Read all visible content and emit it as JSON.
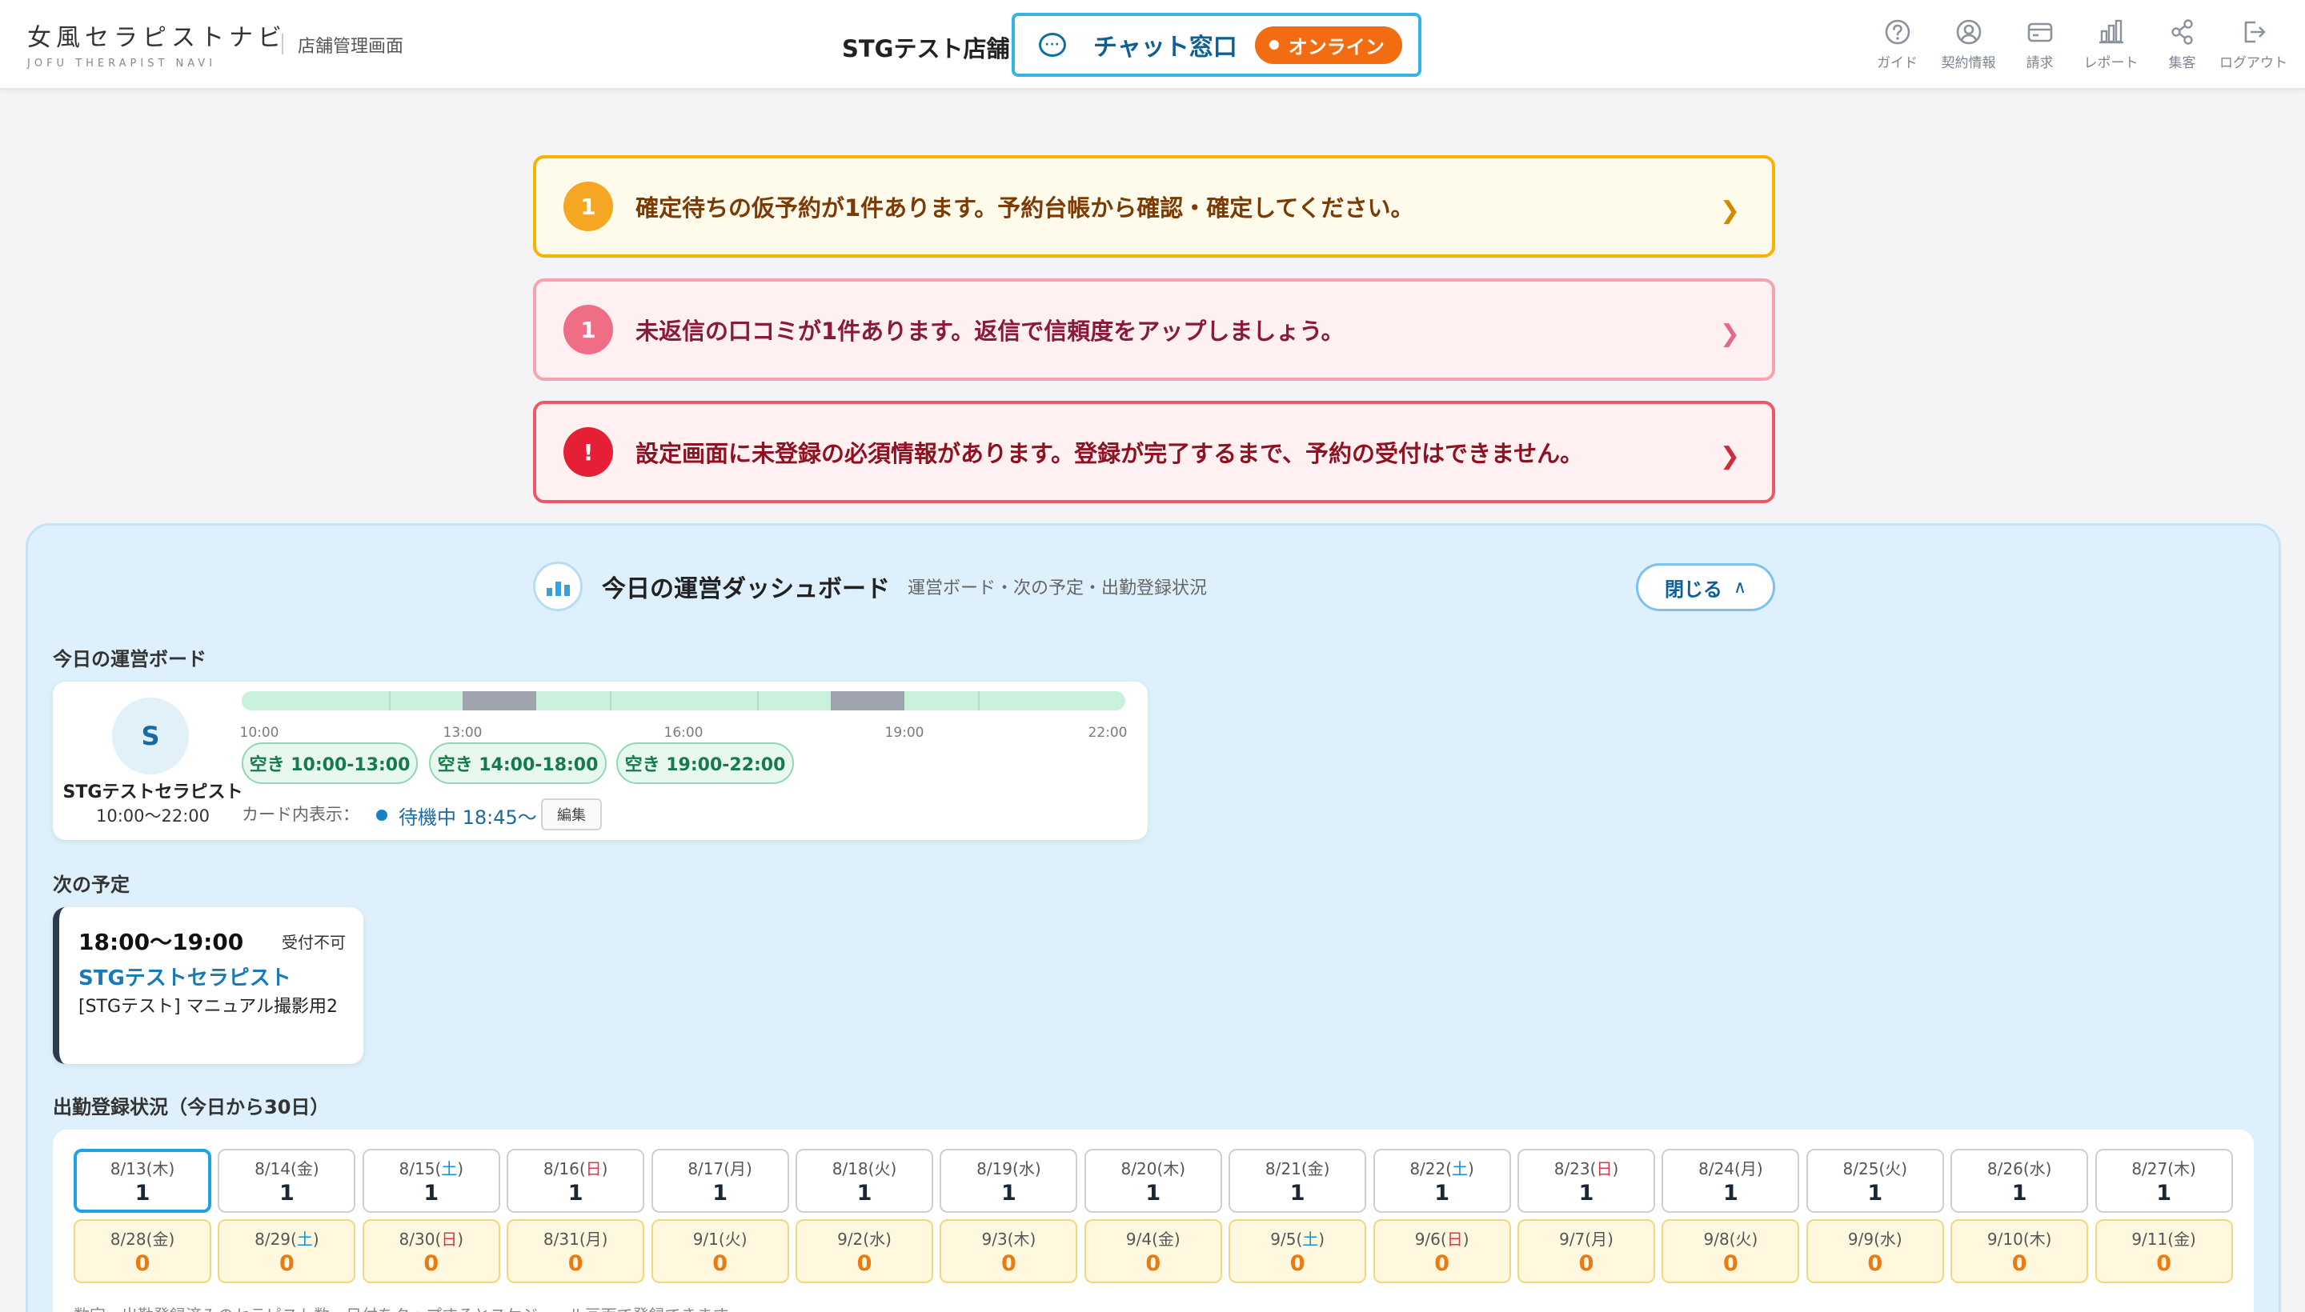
{
  "header": {
    "logo_main": "女風セラピストナビ",
    "logo_sub": "JOFU THERAPIST NAVI",
    "area_label": "店舗管理画面",
    "store_name": "STGテスト店舗",
    "chat_label": "チャット窓口",
    "online_label": "オンライン",
    "nav": [
      {
        "label": "ガイド",
        "icon": "question-circle-icon"
      },
      {
        "label": "契約情報",
        "icon": "user-circle-icon"
      },
      {
        "label": "請求",
        "icon": "credit-card-icon"
      },
      {
        "label": "レポート",
        "icon": "bar-chart-icon"
      },
      {
        "label": "集客",
        "icon": "share-icon"
      },
      {
        "label": "ログアウト",
        "icon": "logout-icon"
      }
    ]
  },
  "alerts": [
    {
      "num": "1",
      "text": "確定待ちの仮予約が1件あります。予約台帳から確認・確定してください。"
    },
    {
      "num": "1",
      "text": "未返信の口コミが1件あります。返信で信頼度をアップしましょう。"
    },
    {
      "num": "!",
      "text": "設定画面に未登録の必須情報があります。登録が完了するまで、予約の受付はできません。"
    }
  ],
  "dashboard": {
    "title": "今日の運営ダッシュボード",
    "subtitle": "運営ボード・次の予定・出勤登録状況",
    "close_label": "閉じる",
    "board_label": "今日の運営ボード",
    "next_label": "次の予定",
    "attendance_label": "出勤登録状況（今日から30日）"
  },
  "board": {
    "avatar": "S",
    "therapist_name": "STGテストセラピスト",
    "hours": "10:00〜22:00",
    "timeline_labels": [
      "10:00",
      "13:00",
      "16:00",
      "19:00",
      "22:00"
    ],
    "slots": [
      "空き 10:00-13:00",
      "空き 14:00-18:00",
      "空き 19:00-22:00"
    ],
    "card_display_label": "カード内表示：",
    "status_text": "待機中 18:45〜",
    "edit_label": "編集"
  },
  "next": {
    "time": "18:00〜19:00",
    "status": "受付不可",
    "therapist": "STGテストセラピスト",
    "course": "[STGテスト] マニュアル撮影用2"
  },
  "attendance": {
    "row1": [
      {
        "date": "8/13",
        "dow": "木",
        "count": "1",
        "today": true
      },
      {
        "date": "8/14",
        "dow": "金",
        "count": "1"
      },
      {
        "date": "8/15",
        "dow": "土",
        "count": "1"
      },
      {
        "date": "8/16",
        "dow": "日",
        "count": "1"
      },
      {
        "date": "8/17",
        "dow": "月",
        "count": "1"
      },
      {
        "date": "8/18",
        "dow": "火",
        "count": "1"
      },
      {
        "date": "8/19",
        "dow": "水",
        "count": "1"
      },
      {
        "date": "8/20",
        "dow": "木",
        "count": "1"
      },
      {
        "date": "8/21",
        "dow": "金",
        "count": "1"
      },
      {
        "date": "8/22",
        "dow": "土",
        "count": "1"
      },
      {
        "date": "8/23",
        "dow": "日",
        "count": "1"
      },
      {
        "date": "8/24",
        "dow": "月",
        "count": "1"
      },
      {
        "date": "8/25",
        "dow": "火",
        "count": "1"
      },
      {
        "date": "8/26",
        "dow": "水",
        "count": "1"
      },
      {
        "date": "8/27",
        "dow": "木",
        "count": "1"
      }
    ],
    "row2": [
      {
        "date": "8/28",
        "dow": "金",
        "count": "0"
      },
      {
        "date": "8/29",
        "dow": "土",
        "count": "0"
      },
      {
        "date": "8/30",
        "dow": "日",
        "count": "0"
      },
      {
        "date": "8/31",
        "dow": "月",
        "count": "0"
      },
      {
        "date": "9/1",
        "dow": "火",
        "count": "0"
      },
      {
        "date": "9/2",
        "dow": "水",
        "count": "0"
      },
      {
        "date": "9/3",
        "dow": "木",
        "count": "0"
      },
      {
        "date": "9/4",
        "dow": "金",
        "count": "0"
      },
      {
        "date": "9/5",
        "dow": "土",
        "count": "0"
      },
      {
        "date": "9/6",
        "dow": "日",
        "count": "0"
      },
      {
        "date": "9/7",
        "dow": "月",
        "count": "0"
      },
      {
        "date": "9/8",
        "dow": "火",
        "count": "0"
      },
      {
        "date": "9/9",
        "dow": "水",
        "count": "0"
      },
      {
        "date": "9/10",
        "dow": "木",
        "count": "0"
      },
      {
        "date": "9/11",
        "dow": "金",
        "count": "0"
      }
    ],
    "note": "数字＝出勤登録済みのセラピスト数。日付をタップするとスケジュール画面で登録できます。"
  },
  "colors": {
    "accent": "#37b4e6",
    "online": "#f26d12",
    "warning": "#f8b300",
    "danger": "#e51f35",
    "free_slot": "#c9f1dc",
    "booked_slot": "#9ea3ad"
  }
}
